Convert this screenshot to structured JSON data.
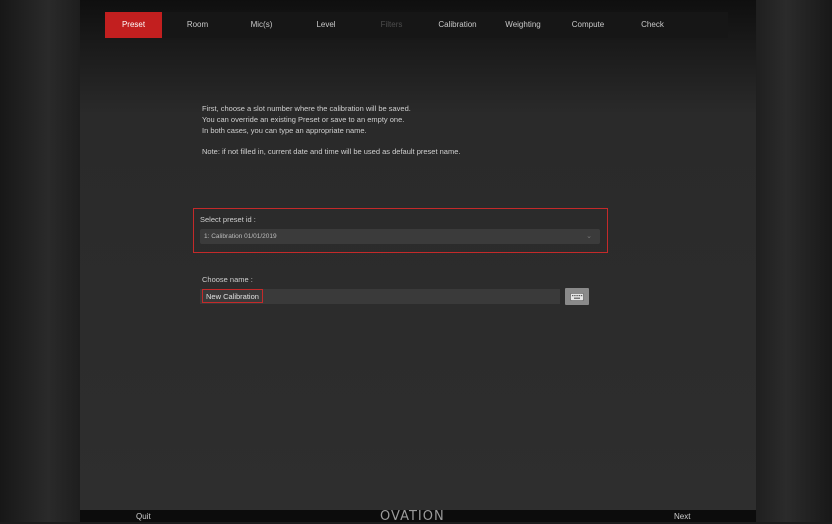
{
  "tabs": [
    {
      "label": "Preset",
      "state": "active"
    },
    {
      "label": "Room",
      "state": "normal"
    },
    {
      "label": "Mic(s)",
      "state": "normal"
    },
    {
      "label": "Level",
      "state": "normal"
    },
    {
      "label": "Filters",
      "state": "disabled"
    },
    {
      "label": "Calibration",
      "state": "normal"
    },
    {
      "label": "Weighting",
      "state": "normal"
    },
    {
      "label": "Compute",
      "state": "normal"
    },
    {
      "label": "Check",
      "state": "normal"
    }
  ],
  "instructions": {
    "line1": "First, choose a slot number where the calibration will be saved.",
    "line2": "You can override an existing Preset or save to an empty one.",
    "line3": "In both cases, you can type an appropriate name.",
    "note": "Note: if not filled in, current date and time will be used as default preset name."
  },
  "preset": {
    "label": "Select preset id :",
    "selected": "1: Calibration 01/01/2019"
  },
  "name": {
    "label": "Choose name :",
    "value": "New Calibration"
  },
  "footer": {
    "quit": "Quit",
    "logo": "OVATION",
    "next": "Next"
  },
  "colors": {
    "accent": "#c21f1f",
    "background": "#2e2e2e",
    "tabbar": "#161616"
  },
  "icons": {
    "keyboard": "keyboard-icon",
    "dropdown": "chevron-down-icon"
  }
}
